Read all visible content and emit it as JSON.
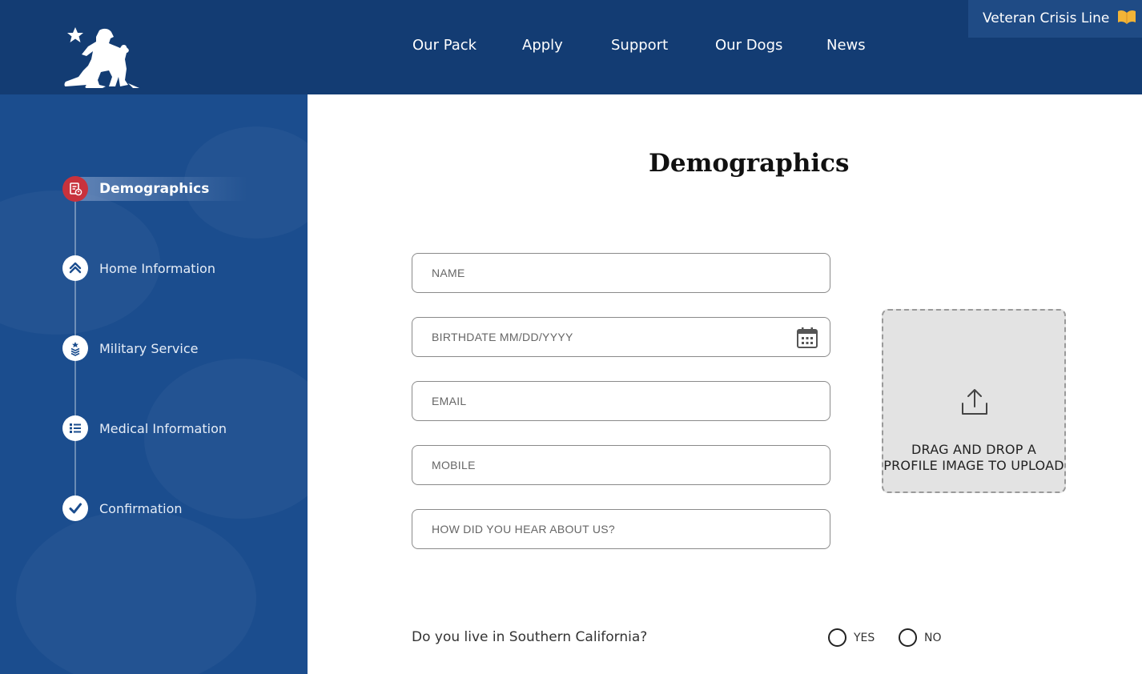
{
  "header": {
    "logo_icon": "veteran-kneeling-with-dog-logo",
    "nav": [
      "Our Pack",
      "Apply",
      "Support",
      "Our Dogs",
      "News"
    ],
    "crisis_line": {
      "label": "Veteran Crisis Line",
      "icon": "book-icon"
    }
  },
  "colors": {
    "header_bg": "#133c73",
    "sidebar_bg": "#1b4d8e",
    "active_step": "#c8323c",
    "crisis_accent": "#f2b437"
  },
  "sidebar": {
    "steps": [
      {
        "label": "Demographics",
        "icon": "document-person-icon",
        "active": true
      },
      {
        "label": "Home Information",
        "icon": "home-chevron-icon",
        "active": false
      },
      {
        "label": "Military Service",
        "icon": "military-rank-icon",
        "active": false
      },
      {
        "label": "Medical Information",
        "icon": "list-icon",
        "active": false
      },
      {
        "label": "Confirmation",
        "icon": "checkmark-icon",
        "active": false
      }
    ]
  },
  "main": {
    "title": "Demographics",
    "fields": {
      "name": {
        "placeholder": "NAME",
        "value": ""
      },
      "birthdate": {
        "placeholder": "BIRTHDATE MM/DD/YYYY",
        "value": "",
        "icon": "calendar-icon"
      },
      "email": {
        "placeholder": "EMAIL",
        "value": ""
      },
      "mobile": {
        "placeholder": "MOBILE",
        "value": ""
      },
      "referral": {
        "placeholder": "HOW DID YOU HEAR ABOUT US?",
        "value": ""
      }
    },
    "upload": {
      "text": "DRAG AND DROP A PROFILE IMAGE TO UPLOAD",
      "icon": "upload-icon"
    },
    "question": {
      "text": "Do you live in Southern California?",
      "options": [
        "YES",
        "NO"
      ],
      "selected": null
    }
  }
}
